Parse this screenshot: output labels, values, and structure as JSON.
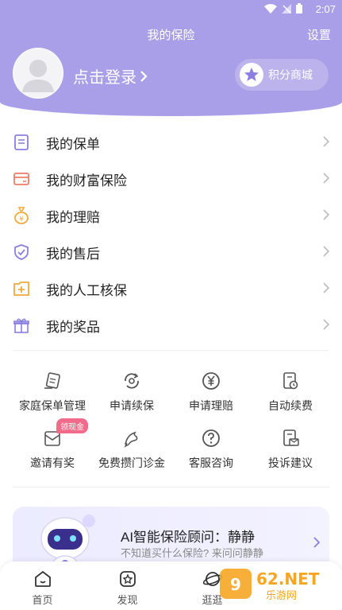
{
  "status_bar": {
    "time": "2:07"
  },
  "header": {
    "title": "我的保险",
    "settings": "设置",
    "login": "点击登录",
    "points_mall": "积分商城",
    "bg_color": "#a99ee8"
  },
  "menu": [
    {
      "label": "我的保单",
      "icon": "document-icon"
    },
    {
      "label": "我的财富保险",
      "icon": "card-icon"
    },
    {
      "label": "我的理赔",
      "icon": "money-bag-icon"
    },
    {
      "label": "我的售后",
      "icon": "shield-icon"
    },
    {
      "label": "我的人工核保",
      "icon": "medical-folder-icon"
    },
    {
      "label": "我的奖品",
      "icon": "gift-icon"
    }
  ],
  "services": [
    {
      "label": "家庭保单管理",
      "icon": "policy-stack-icon"
    },
    {
      "label": "申请续保",
      "icon": "renew-icon"
    },
    {
      "label": "申请理赔",
      "icon": "yen-icon"
    },
    {
      "label": "自动续费",
      "icon": "auto-pay-icon"
    },
    {
      "label": "邀请有奖",
      "icon": "invite-icon",
      "badge": "领现金"
    },
    {
      "label": "免费攒门诊金",
      "icon": "dolphin-icon"
    },
    {
      "label": "客服咨询",
      "icon": "help-icon"
    },
    {
      "label": "投诉建议",
      "icon": "complaint-icon"
    }
  ],
  "ai_card": {
    "title": "AI智能保险顾问：静静",
    "subtitle": "不知道买什么保险? 来问问静静"
  },
  "bottom_nav": [
    {
      "label": "首页",
      "icon": "home-icon"
    },
    {
      "label": "发现",
      "icon": "discover-icon"
    },
    {
      "label": "逛逛",
      "icon": "planet-icon"
    }
  ],
  "watermark": {
    "brand": "962.NET",
    "sub": "乐游网"
  }
}
